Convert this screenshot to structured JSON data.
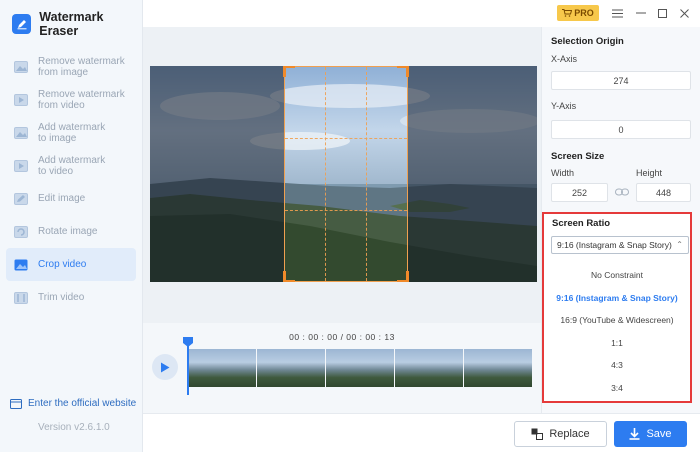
{
  "app": {
    "title": "Watermark Eraser"
  },
  "sidebar": {
    "items": [
      {
        "label": "Remove watermark from image",
        "line1": "Remove watermark",
        "line2": "from image",
        "icon": "image-remove-icon",
        "active": false
      },
      {
        "label": "Remove watermark from video",
        "line1": "Remove watermark",
        "line2": "from video",
        "icon": "video-remove-icon",
        "active": false
      },
      {
        "label": "Add watermark to image",
        "line1": "Add watermark",
        "line2": "to image",
        "icon": "image-add-icon",
        "active": false
      },
      {
        "label": "Add watermark to video",
        "line1": "Add watermark",
        "line2": "to video",
        "icon": "video-add-icon",
        "active": false
      },
      {
        "label": "Edit image",
        "line1": "Edit image",
        "line2": "",
        "icon": "edit-image-icon",
        "active": false
      },
      {
        "label": "Rotate image",
        "line1": "Rotate image",
        "line2": "",
        "icon": "rotate-image-icon",
        "active": false
      },
      {
        "label": "Crop video",
        "line1": "Crop video",
        "line2": "",
        "icon": "crop-video-icon",
        "active": true
      },
      {
        "label": "Trim video",
        "line1": "Trim video",
        "line2": "",
        "icon": "trim-video-icon",
        "active": false
      }
    ],
    "website_label": "Enter the official website",
    "version": "Version v2.6.1.0"
  },
  "titlebar": {
    "pro_label": "PRO"
  },
  "timeline": {
    "time": "00 : 00 : 00 / 00 : 00 : 13"
  },
  "panel": {
    "selection_origin": "Selection Origin",
    "x_label": "X-Axis",
    "x_value": "274",
    "y_label": "Y-Axis",
    "y_value": "0",
    "screen_size": "Screen Size",
    "width_label": "Width",
    "width_value": "252",
    "height_label": "Height",
    "height_value": "448",
    "screen_ratio": "Screen Ratio",
    "ratio_selected": "9:16 (Instagram & Snap Story)",
    "ratio_options": [
      "No Constraint",
      "9:16 (Instagram & Snap Story)",
      "16:9 (YouTube & Widescreen)",
      "1:1",
      "4:3",
      "3:4"
    ]
  },
  "buttons": {
    "replace": "Replace",
    "save": "Save"
  },
  "colors": {
    "accent": "#2d7cf0",
    "crop_border": "#f08a2a",
    "highlight_border": "#e53a3a",
    "pro_badge": "#f7c84b"
  }
}
